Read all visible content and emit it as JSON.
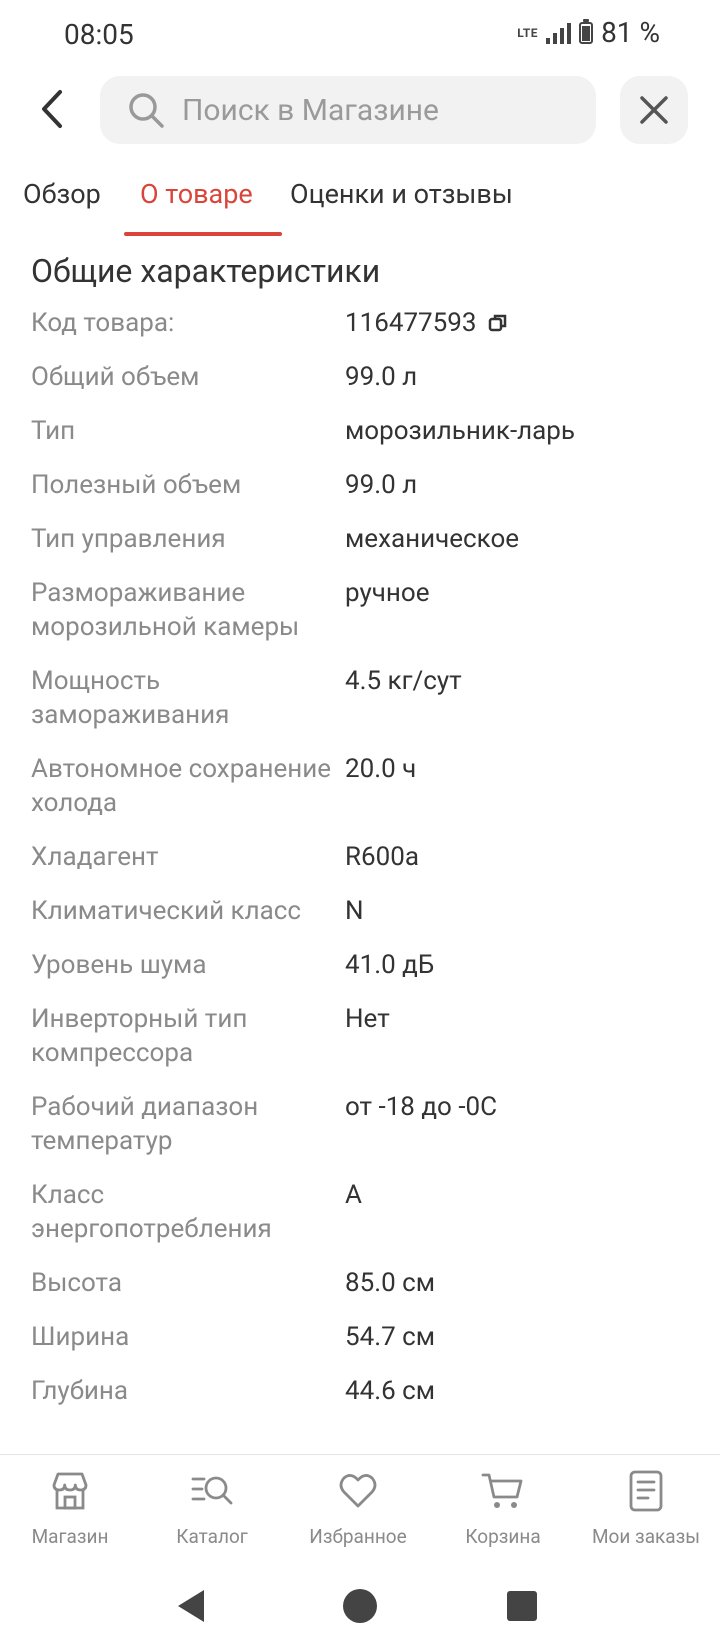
{
  "status": {
    "time": "08:05",
    "network": "LTE",
    "battery": "81 %"
  },
  "search": {
    "placeholder": "Поиск в Магазине"
  },
  "tabs": [
    {
      "label": "Обзор"
    },
    {
      "label": "О товаре"
    },
    {
      "label": "Оценки и отзывы"
    }
  ],
  "section": {
    "title": "Общие характеристики"
  },
  "specs": [
    {
      "label": "Код товара:",
      "value": "116477593"
    },
    {
      "label": "Общий объем",
      "value": "99.0 л"
    },
    {
      "label": "Тип",
      "value": "морозильник-ларь"
    },
    {
      "label": "Полезный объем",
      "value": "99.0 л"
    },
    {
      "label": "Тип управления",
      "value": "механическое"
    },
    {
      "label": "Размораживание морозильной камеры",
      "value": "ручное"
    },
    {
      "label": "Мощность замораживания",
      "value": "4.5 кг/сут"
    },
    {
      "label": "Автономное сохранение холода",
      "value": "20.0 ч"
    },
    {
      "label": "Хладагент",
      "value": "R600a"
    },
    {
      "label": "Климатический класс",
      "value": "N"
    },
    {
      "label": "Уровень шума",
      "value": "41.0 дБ"
    },
    {
      "label": "Инверторный тип компрессора",
      "value": "Нет"
    },
    {
      "label": "Рабочий диапазон температур",
      "value": "от -18 до -0С"
    },
    {
      "label": "Класс энергопотребления",
      "value": "A"
    },
    {
      "label": "Высота",
      "value": "85.0 см"
    },
    {
      "label": "Ширина",
      "value": "54.7 см"
    },
    {
      "label": "Глубина",
      "value": "44.6 см"
    }
  ],
  "bottom_nav": [
    {
      "label": "Магазин",
      "icon": "store-icon"
    },
    {
      "label": "Каталог",
      "icon": "catalog-search-icon"
    },
    {
      "label": "Избранное",
      "icon": "heart-icon"
    },
    {
      "label": "Корзина",
      "icon": "cart-icon"
    },
    {
      "label": "Мои заказы",
      "icon": "orders-icon"
    }
  ],
  "colors": {
    "accent": "#d9453a"
  }
}
